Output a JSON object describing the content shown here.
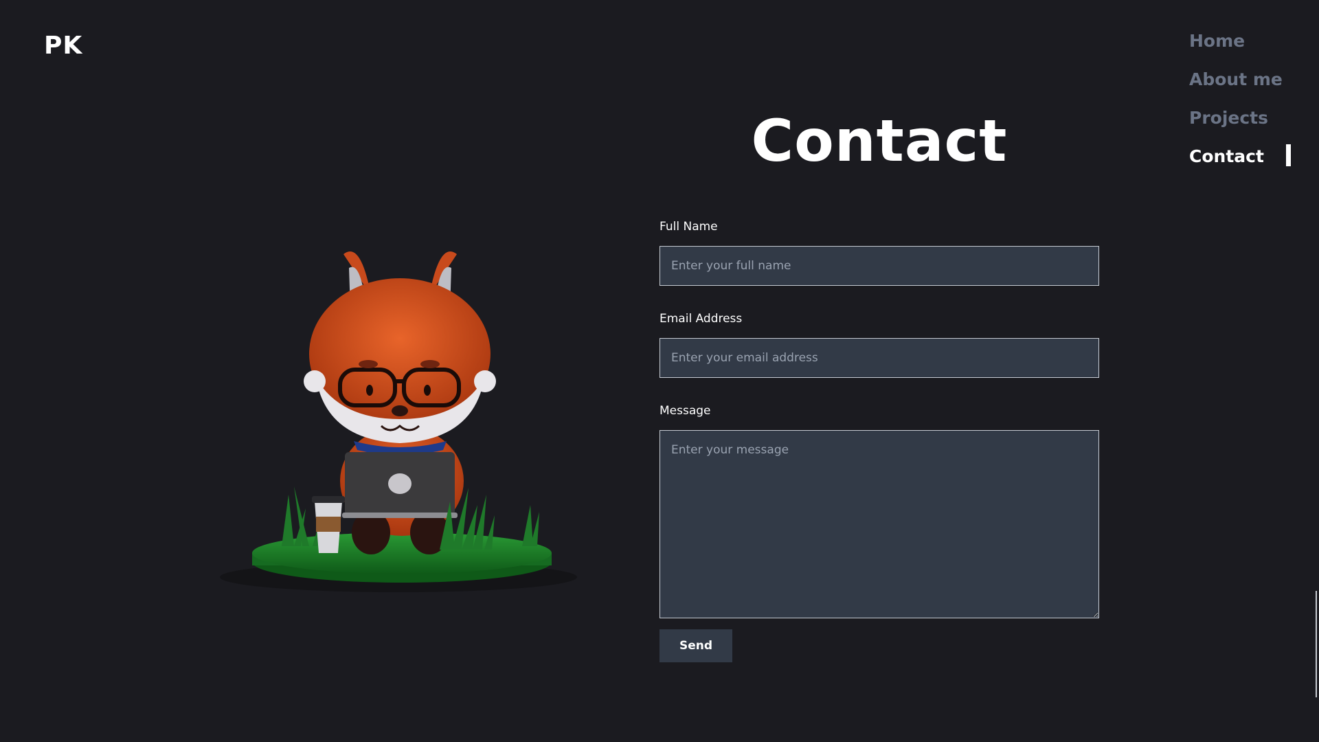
{
  "header": {
    "logo": "PK"
  },
  "nav": {
    "items": [
      {
        "label": "Home",
        "active": false
      },
      {
        "label": "About me",
        "active": false
      },
      {
        "label": "Projects",
        "active": false
      },
      {
        "label": "Contact",
        "active": true
      }
    ]
  },
  "main": {
    "title": "Contact",
    "illustration_icon": "fox-with-laptop-illustration"
  },
  "form": {
    "full_name": {
      "label": "Full Name",
      "placeholder": "Enter your full name",
      "value": ""
    },
    "email": {
      "label": "Email Address",
      "placeholder": "Enter your email address",
      "value": ""
    },
    "message": {
      "label": "Message",
      "placeholder": "Enter your message",
      "value": ""
    },
    "send_label": "Send"
  },
  "colors": {
    "background": "#1b1b20",
    "input_background": "#323a47",
    "nav_inactive": "#6b7486",
    "nav_active": "#ffffff"
  }
}
